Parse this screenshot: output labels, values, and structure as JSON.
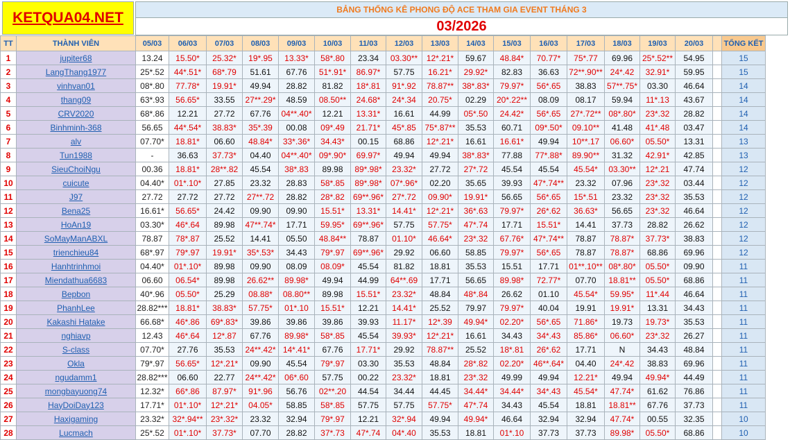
{
  "logo": "KETQUA04.NET",
  "banner_title": "BẢNG THỐNG KÊ PHONG ĐỘ ACE THAM GIA EVENT THÁNG 3",
  "month": "03/2026",
  "headers": {
    "tt": "TT",
    "member": "THÀNH VIÊN",
    "dates": [
      "05/03",
      "06/03",
      "07/03",
      "08/03",
      "09/03",
      "10/03",
      "11/03",
      "12/03",
      "13/03",
      "14/03",
      "15/03",
      "16/03",
      "17/03",
      "18/03",
      "19/03",
      "20/03"
    ],
    "total": "TỔNG KẾT"
  },
  "rows": [
    {
      "tt": "1",
      "name": "jupiter68",
      "cells": [
        "13.24",
        "15.50*",
        "25.32*",
        "19*.95",
        "13.33*",
        "58*.80",
        "23.34",
        "03.30**",
        "12*.21*",
        "59.67",
        "48.84*",
        "70.77*",
        "75*.77",
        "69.96",
        "25*.52**",
        "54.95"
      ],
      "total": "15"
    },
    {
      "tt": "2",
      "name": "LangThang1977",
      "cells": [
        "25*.52",
        "44*.51*",
        "68*.79",
        "51.61",
        "67.76",
        "51*.91*",
        "86.97*",
        "57.75",
        "16.21*",
        "29.92*",
        "82.83",
        "36.63",
        "72**.90**",
        "24*.42",
        "32.91*",
        "59.95"
      ],
      "total": "15"
    },
    {
      "tt": "3",
      "name": "vinhvan01",
      "cells": [
        "08*.80",
        "77.78*",
        "19.91*",
        "49.94",
        "28.82",
        "81.82",
        "18*.81",
        "91*.92",
        "78.87**",
        "38*.83*",
        "79.97*",
        "56*.65",
        "38.83",
        "57**.75*",
        "03.30",
        "46.64"
      ],
      "total": "14"
    },
    {
      "tt": "4",
      "name": "thang09",
      "cells": [
        "63*.93",
        "56.65*",
        "33.55",
        "27**.29*",
        "48.59",
        "08.50**",
        "24.68*",
        "24*.34",
        "20.75*",
        "02.29",
        "20*.22**",
        "08.09",
        "08.17",
        "59.94",
        "11*.13",
        "43.67"
      ],
      "total": "14"
    },
    {
      "tt": "5",
      "name": "CRV2020",
      "cells": [
        "68*.86",
        "12.21",
        "27.72",
        "67.76",
        "04**.40*",
        "12.21",
        "13.31*",
        "16.61",
        "44.99",
        "05*.50",
        "24.42*",
        "56*.65",
        "27*.72**",
        "08*.80*",
        "23*.32",
        "28.82"
      ],
      "total": "14"
    },
    {
      "tt": "6",
      "name": "Binhminh-368",
      "cells": [
        "56.65",
        "44*.54*",
        "38.83*",
        "35*.39",
        "00.08",
        "09*.49",
        "21.71*",
        "45*.85",
        "75*.87**",
        "35.53",
        "60.71",
        "09*.50*",
        "09.10**",
        "41.48",
        "41*.48",
        "03.47"
      ],
      "total": "14"
    },
    {
      "tt": "7",
      "name": "alv",
      "cells": [
        "07.70*",
        "18.81*",
        "06.60",
        "48.84*",
        "33*.36*",
        "34.43*",
        "00.15",
        "68.86",
        "12*.21*",
        "16.61",
        "16.61*",
        "49.94",
        "10**.17",
        "06.60*",
        "05.50*",
        "13.31"
      ],
      "total": "13"
    },
    {
      "tt": "8",
      "name": "Tun1988",
      "cells": [
        "-",
        "36.63",
        "37.73*",
        "04.40",
        "04**.40*",
        "09*.90*",
        "69.97*",
        "49.94",
        "49.94",
        "38*.83*",
        "77.88",
        "77*.88*",
        "89.90**",
        "31.32",
        "42.91*",
        "42.85"
      ],
      "total": "13"
    },
    {
      "tt": "9",
      "name": "SieuChoiNgu",
      "cells": [
        "00.36",
        "18.81*",
        "28**.82",
        "45.54",
        "38*.83",
        "89.98",
        "89*.98*",
        "23.32*",
        "27.72",
        "27*.72",
        "45.54",
        "45.54",
        "45.54*",
        "03.30**",
        "12*.21",
        "47.74"
      ],
      "total": "12"
    },
    {
      "tt": "10",
      "name": "cuicute",
      "cells": [
        "04.40*",
        "01*.10*",
        "27.85",
        "23.32",
        "28.83",
        "58*.85",
        "89*.98*",
        "07*.96*",
        "02.20",
        "35.65",
        "39.93",
        "47*.74**",
        "23.32",
        "07.96",
        "23*.32",
        "03.44"
      ],
      "total": "12"
    },
    {
      "tt": "11",
      "name": "J97",
      "cells": [
        "27.72",
        "27.72",
        "27.72",
        "27**.72",
        "28.82",
        "28*.82",
        "69**.96*",
        "27*.72",
        "09.90*",
        "19.91*",
        "56.65",
        "56*.65",
        "15*.51",
        "23.32",
        "23*.32",
        "35.53"
      ],
      "total": "12"
    },
    {
      "tt": "12",
      "name": "Bena25",
      "cells": [
        "16.61*",
        "56.65*",
        "24.42",
        "09.90",
        "09.90",
        "15.51*",
        "13.31*",
        "14.41*",
        "12*.21*",
        "36*.63",
        "79.97*",
        "26*.62",
        "36.63*",
        "56.65",
        "23*.32",
        "46.64"
      ],
      "total": "12"
    },
    {
      "tt": "13",
      "name": "HoAn19",
      "cells": [
        "03.30*",
        "46*.64",
        "89.98",
        "47**.74*",
        "17.71",
        "59.95*",
        "69**.96*",
        "57.75",
        "57.75*",
        "47*.74",
        "17.71",
        "15.51*",
        "14.41",
        "37.73",
        "28.82",
        "26.62"
      ],
      "total": "12"
    },
    {
      "tt": "14",
      "name": "SoMayManABXL",
      "cells": [
        "78.87",
        "78*.87",
        "25.52",
        "14.41",
        "05.50",
        "48.84**",
        "78.87",
        "01.10*",
        "46.64*",
        "23*.32",
        "67.76*",
        "47*.74**",
        "78.87",
        "78.87*",
        "37.73*",
        "38.83"
      ],
      "total": "12"
    },
    {
      "tt": "15",
      "name": "trienchieu84",
      "cells": [
        "68*.97",
        "79*.97",
        "19.91*",
        "35*.53*",
        "34.43",
        "79*.97",
        "69**.96*",
        "29.92",
        "06.60",
        "58.85",
        "79.97*",
        "56*.65",
        "78.87",
        "78.87*",
        "68.86",
        "69.96"
      ],
      "total": "12"
    },
    {
      "tt": "16",
      "name": "Hanhtrinhmoi",
      "cells": [
        "04.40*",
        "01*.10*",
        "89.98",
        "09.90",
        "08.09",
        "08.09*",
        "45.54",
        "81.82",
        "18.81",
        "35.53",
        "15.51",
        "17.71",
        "01**.10**",
        "08*.80*",
        "05.50*",
        "09.90"
      ],
      "total": "11"
    },
    {
      "tt": "17",
      "name": "Miendathua6683",
      "cells": [
        "06.60",
        "06.54*",
        "89.98",
        "26.62**",
        "89.98*",
        "49.94",
        "44.99",
        "64**.69",
        "17.71",
        "56.65",
        "89.98*",
        "72.77*",
        "07.70",
        "18.81**",
        "05.50*",
        "68.86"
      ],
      "total": "11"
    },
    {
      "tt": "18",
      "name": "Bepbon",
      "cells": [
        "40*.96",
        "05.50*",
        "25.29",
        "08.88*",
        "08.80**",
        "89.98",
        "15.51*",
        "23.32*",
        "48.84",
        "48*.84",
        "26.62",
        "01.10",
        "45.54*",
        "59.95*",
        "11*.44",
        "46.64"
      ],
      "total": "11"
    },
    {
      "tt": "19",
      "name": "PhanhLee",
      "cells": [
        "28.82***",
        "18.81*",
        "38.83*",
        "57.75*",
        "01*.10",
        "15.51*",
        "12.21",
        "14.41*",
        "25.52",
        "79.97",
        "79.97*",
        "40.04",
        "19.91",
        "19.91*",
        "13.31",
        "34.43"
      ],
      "total": "11"
    },
    {
      "tt": "20",
      "name": "Kakashi Hatake",
      "cells": [
        "66.68*",
        "46*.86",
        "69*.83*",
        "39.86",
        "39.86",
        "39.86",
        "39.93",
        "11.17*",
        "12*.39",
        "49.94*",
        "02.20*",
        "56*.65",
        "71.86*",
        "19.73",
        "19.73*",
        "35.53"
      ],
      "total": "11"
    },
    {
      "tt": "21",
      "name": "nghiavp",
      "cells": [
        "12.43",
        "46*.64",
        "12*.87",
        "67.76",
        "89.98*",
        "58*.85",
        "45.54",
        "39.93*",
        "12*.21*",
        "16.61",
        "34.43",
        "34*.43",
        "85.86*",
        "06.60*",
        "23*.32",
        "26.27"
      ],
      "total": "11"
    },
    {
      "tt": "22",
      "name": "S-class",
      "cells": [
        "07.70*",
        "27.76",
        "35.53",
        "24**.42*",
        "14*.41*",
        "67.76",
        "17.71*",
        "29.92",
        "78.87**",
        "25.52",
        "18*.81",
        "26*.62",
        "17.71",
        "N",
        "34.43",
        "48.84"
      ],
      "total": "11"
    },
    {
      "tt": "23",
      "name": "Okla",
      "cells": [
        "79*.97",
        "56.65*",
        "12*.21*",
        "09.90",
        "45.54",
        "79*.97",
        "03.30",
        "35.53",
        "48.84",
        "28*.82",
        "02.20*",
        "46**.64*",
        "04.40",
        "24*.42",
        "38.83",
        "69.96"
      ],
      "total": "11"
    },
    {
      "tt": "24",
      "name": "ngudamm1",
      "cells": [
        "28.82***",
        "06.60",
        "22.77",
        "24**.42*",
        "06*.60",
        "57.75",
        "00.22",
        "23.32*",
        "18.81",
        "23*.32",
        "49.99",
        "49.94",
        "12.21*",
        "49.94",
        "49.94*",
        "44.49"
      ],
      "total": "11"
    },
    {
      "tt": "25",
      "name": "mongbayuong74",
      "cells": [
        "12.32*",
        "66*.86",
        "87.97*",
        "91*.96",
        "56.76",
        "02**.20",
        "44.54",
        "34.44",
        "44.45",
        "34.44*",
        "34.44*",
        "34*.43",
        "45.54*",
        "47.74*",
        "61.62",
        "76.86"
      ],
      "total": "11"
    },
    {
      "tt": "26",
      "name": "HayDoiDay123",
      "cells": [
        "17.71*",
        "01*.10*",
        "12*.21*",
        "04.05*",
        "58.85",
        "58*.85",
        "57.75",
        "57.75",
        "57.75*",
        "47*.74",
        "34.43",
        "45.54",
        "18.81",
        "18.81**",
        "67.76",
        "37.73"
      ],
      "total": "11"
    },
    {
      "tt": "27",
      "name": "Haxigaming",
      "cells": [
        "23.32*",
        "32*.94**",
        "23*.32*",
        "23.32",
        "32.94",
        "79*.97",
        "12.21",
        "32*.94",
        "49.94",
        "49.94*",
        "46.64",
        "32.94",
        "32.94",
        "47.74*",
        "00.55",
        "32.35"
      ],
      "total": "10"
    },
    {
      "tt": "28",
      "name": "Lucmach",
      "cells": [
        "25*.52",
        "01*.10*",
        "37.73*",
        "07.70",
        "28.82",
        "37*.73",
        "47*.74",
        "04*.40",
        "35.53",
        "18.81",
        "01*.10",
        "37.73",
        "37.73",
        "89.98*",
        "05.50*",
        "68.86"
      ],
      "total": "10"
    }
  ],
  "colors": {
    "logo_bg": "#ffff00",
    "logo_text": "#e00000",
    "banner_text": "#f07a1e",
    "member_bg": "#d7d0ea",
    "header_bg": "#ffe1b8",
    "star_text": "#e00000",
    "link_blue": "#1f5fb0"
  }
}
